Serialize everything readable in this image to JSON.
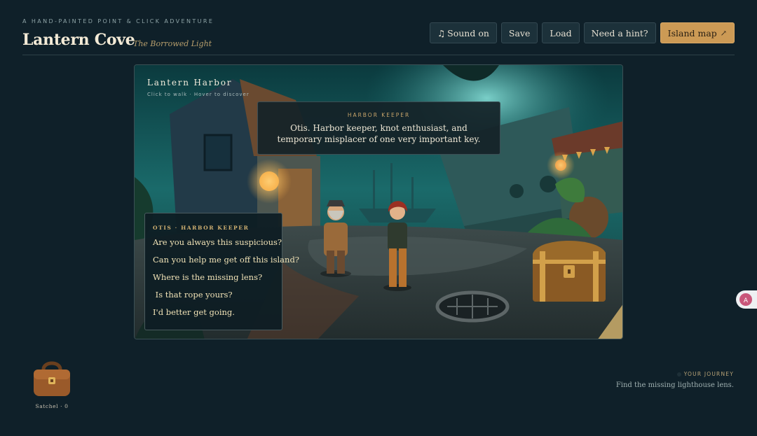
{
  "header": {
    "tagline": "A HAND-PAINTED POINT & CLICK ADVENTURE",
    "title": "Lantern Cove",
    "subtitle": "The Borrowed Light"
  },
  "nav": {
    "sound": {
      "icon": "music-note-icon",
      "glyph": "♫",
      "label": "Sound on"
    },
    "save": "Save",
    "load": "Load",
    "hint": "Need a hint?",
    "map": {
      "label": "Island map",
      "icon": "external-arrow-icon",
      "glyph": "↗"
    }
  },
  "scene": {
    "location": "Lantern Harbor",
    "hint": "Click to walk · Hover to discover",
    "speech": {
      "speaker": "HARBOR KEEPER",
      "text": "Otis. Harbor keeper, knot enthusiast, and temporary misplacer of one very important key."
    },
    "dialog": {
      "heading": "OTIS · HARBOR KEEPER",
      "options": [
        "Are you always this suspicious?",
        "Can you help me get off this island?",
        "Where is the missing lens?",
        " Is that rope yours?",
        "I'd better get going."
      ]
    }
  },
  "inventory": {
    "label": "Satchel · 0",
    "icon": "satchel-icon"
  },
  "journey": {
    "heading": "YOUR JOURNEY",
    "text": "Find the missing lighthouse lens."
  },
  "colors": {
    "accent": "#cc9a55",
    "background": "#0f2029",
    "gold_text": "#f0e2b6"
  }
}
